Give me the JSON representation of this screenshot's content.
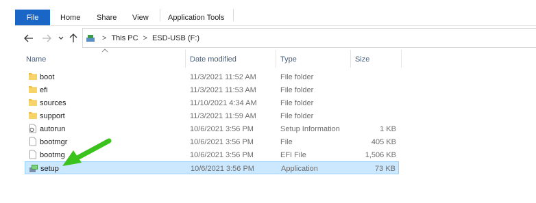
{
  "ribbon": {
    "tabs": [
      "File",
      "Home",
      "Share",
      "View",
      "Application Tools"
    ]
  },
  "nav": {
    "back_icon": "back-arrow-icon",
    "forward_icon": "forward-arrow-icon",
    "recent_icon": "chevron-down-icon",
    "up_icon": "up-arrow-icon"
  },
  "address": {
    "crumbs": [
      "This PC",
      "ESD-USB (F:)"
    ],
    "separator": ">"
  },
  "columns": [
    "Name",
    "Date modified",
    "Type",
    "Size"
  ],
  "files": [
    {
      "name": "boot",
      "date": "11/3/2021 11:52 AM",
      "type": "File folder",
      "size": "",
      "icon": "folder-icon"
    },
    {
      "name": "efi",
      "date": "11/3/2021 11:53 AM",
      "type": "File folder",
      "size": "",
      "icon": "folder-icon"
    },
    {
      "name": "sources",
      "date": "11/10/2021 4:34 AM",
      "type": "File folder",
      "size": "",
      "icon": "folder-icon"
    },
    {
      "name": "support",
      "date": "11/3/2021 11:59 AM",
      "type": "File folder",
      "size": "",
      "icon": "folder-icon"
    },
    {
      "name": "autorun",
      "date": "10/6/2021 3:56 PM",
      "type": "Setup Information",
      "size": "1 KB",
      "icon": "settings-file-icon"
    },
    {
      "name": "bootmgr",
      "date": "10/6/2021 3:56 PM",
      "type": "File",
      "size": "405 KB",
      "icon": "file-icon"
    },
    {
      "name": "bootmg",
      "date": "10/6/2021 3:56 PM",
      "type": "EFI File",
      "size": "1,506 KB",
      "icon": "file-icon"
    },
    {
      "name": "setup",
      "date": "10/6/2021 3:56 PM",
      "type": "Application",
      "size": "73 KB",
      "icon": "setup-app-icon",
      "selected": true
    }
  ],
  "colors": {
    "file_tab": "#1a66c7",
    "folder": "#f0c048",
    "selection_bg": "#cce8ff",
    "selection_border": "#99d1ff",
    "arrow": "#3cc21d"
  }
}
